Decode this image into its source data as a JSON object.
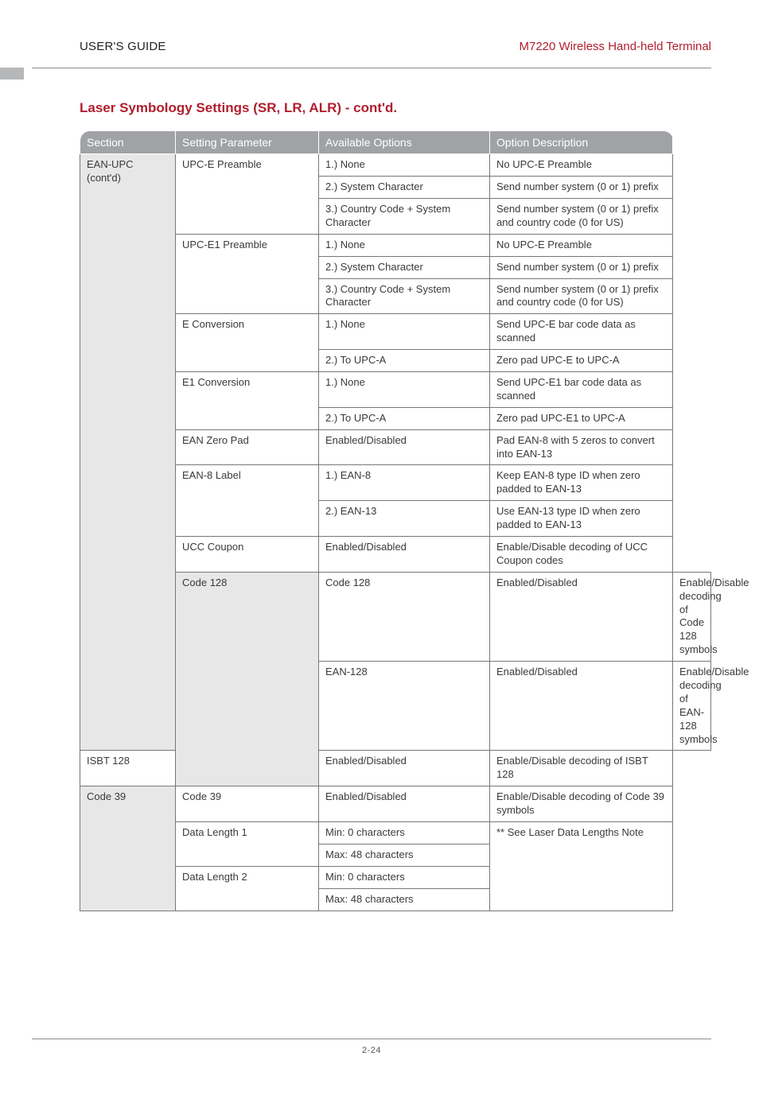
{
  "header": {
    "left": "USER'S GUIDE",
    "right": "M7220 Wireless Hand-held Terminal"
  },
  "title": "Laser Symbology Settings (SR, LR, ALR) - cont'd.",
  "columns": {
    "section": "Section",
    "setting": "Setting Parameter",
    "options": "Available Options",
    "desc": "Option Description"
  },
  "rows": [
    {
      "section": "EAN-UPC (cont'd)",
      "setting": "UPC-E Preamble",
      "option": "1.) None",
      "desc": "No UPC-E Preamble",
      "section_rows": 16,
      "setting_rows": 3
    },
    {
      "option": "2.) System Character",
      "desc": "Send number system (0 or 1) prefix"
    },
    {
      "option": "3.) Country Code + System Character",
      "desc": "Send number system (0 or 1) prefix and country code (0 for US)"
    },
    {
      "setting": "UPC-E1 Preamble",
      "option": "1.) None",
      "desc": "No UPC-E Preamble",
      "setting_rows": 3
    },
    {
      "option": "2.) System Character",
      "desc": "Send number system (0 or 1) prefix"
    },
    {
      "option": "3.) Country Code + System Character",
      "desc": "Send number system (0 or 1) prefix and country code (0 for US)"
    },
    {
      "setting": "E Conversion",
      "option": "1.) None",
      "desc": "Send UPC-E bar code data as scanned",
      "setting_rows": 2
    },
    {
      "option": "2.) To UPC-A",
      "desc": "Zero pad UPC-E to UPC-A"
    },
    {
      "setting": "E1 Conversion",
      "option": "1.) None",
      "desc": "Send UPC-E1 bar code data as scanned",
      "setting_rows": 2
    },
    {
      "option": "2.) To UPC-A",
      "desc": "Zero pad UPC-E1 to UPC-A"
    },
    {
      "setting": "EAN Zero Pad",
      "option": "Enabled/Disabled",
      "desc": "Pad EAN-8 with 5 zeros to convert into EAN-13",
      "setting_rows": 1
    },
    {
      "setting": "EAN-8 Label",
      "option": "1.) EAN-8",
      "desc": "Keep EAN-8 type ID when zero padded to EAN-13",
      "setting_rows": 2
    },
    {
      "option": "2.) EAN-13",
      "desc": "Use EAN-13 type ID when zero padded to EAN-13"
    },
    {
      "setting": "UCC Coupon",
      "option": "Enabled/Disabled",
      "desc": "Enable/Disable decoding of UCC Coupon codes",
      "setting_rows": 1
    },
    {
      "section": "Code 128",
      "setting": "Code 128",
      "option": "Enabled/Disabled",
      "desc": "Enable/Disable decoding of Code 128 symbols",
      "section_rows": 3,
      "setting_rows": 1,
      "section_new": true
    },
    {
      "setting": "EAN-128",
      "option": "Enabled/Disabled",
      "desc": "Enable/Disable decoding of EAN-128 symbols",
      "setting_rows": 1
    },
    {
      "setting": "ISBT 128",
      "option": "Enabled/Disabled",
      "desc": "Enable/Disable decoding of ISBT 128",
      "setting_rows": 1
    },
    {
      "section": "Code 39",
      "setting": "Code 39",
      "option": "Enabled/Disabled",
      "desc": "Enable/Disable decoding of Code 39 symbols",
      "section_rows": 5,
      "setting_rows": 1,
      "section_new": true
    },
    {
      "setting": "Data Length 1",
      "option": "Min: 0 characters",
      "desc": "** See Laser Data Lengths Note",
      "setting_rows": 2,
      "desc_rows": 4
    },
    {
      "option": "Max: 48 characters"
    },
    {
      "setting": "Data Length 2",
      "option": "Min: 0 characters",
      "setting_rows": 2
    },
    {
      "option": "Max: 48 characters"
    }
  ],
  "footer": {
    "page": "2-24"
  }
}
